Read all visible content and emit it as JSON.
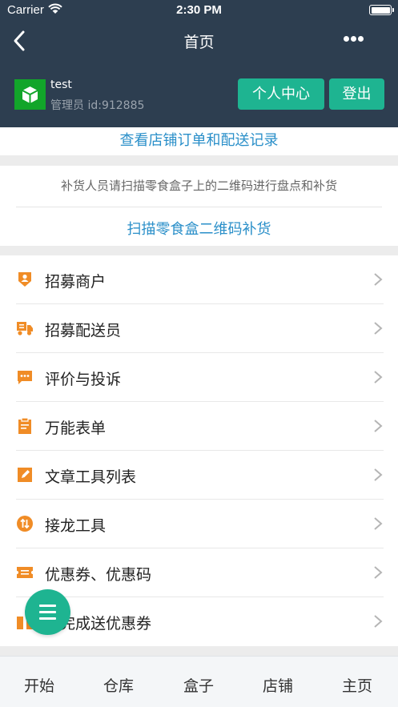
{
  "status_bar": {
    "carrier": "Carrier",
    "time": "2:30 PM"
  },
  "nav": {
    "title": "首页",
    "back_icon": "chevron-left-icon",
    "more_icon": "more-dots-icon"
  },
  "user": {
    "name": "test",
    "role": "管理员 id:912885",
    "avatar_icon": "cube-icon"
  },
  "buttons": {
    "personal_center": "个人中心",
    "logout": "登出"
  },
  "store_link": "查看店铺订单和配送记录",
  "restock": {
    "hint": "补货人员请扫描零食盒子上的二维码进行盘点和补货",
    "scan_link": "扫描零食盒二维码补货"
  },
  "menu": [
    {
      "label": "招募商户",
      "icon": "merchant-shield-icon"
    },
    {
      "label": "招募配送员",
      "icon": "delivery-truck-icon"
    },
    {
      "label": "评价与投诉",
      "icon": "comment-icon"
    },
    {
      "label": "万能表单",
      "icon": "clipboard-icon"
    },
    {
      "label": "文章工具列表",
      "icon": "edit-icon"
    },
    {
      "label": "接龙工具",
      "icon": "relay-icon"
    },
    {
      "label": "优惠券、优惠码",
      "icon": "coupon-icon"
    },
    {
      "label": "订完成送优惠券",
      "icon": "gift-icon"
    }
  ],
  "tabs": [
    "开始",
    "仓库",
    "盒子",
    "店铺",
    "主页"
  ],
  "colors": {
    "header_bg": "#2d3e50",
    "accent": "#1eb491",
    "link": "#2a8fc9",
    "icon": "#f08c26"
  }
}
